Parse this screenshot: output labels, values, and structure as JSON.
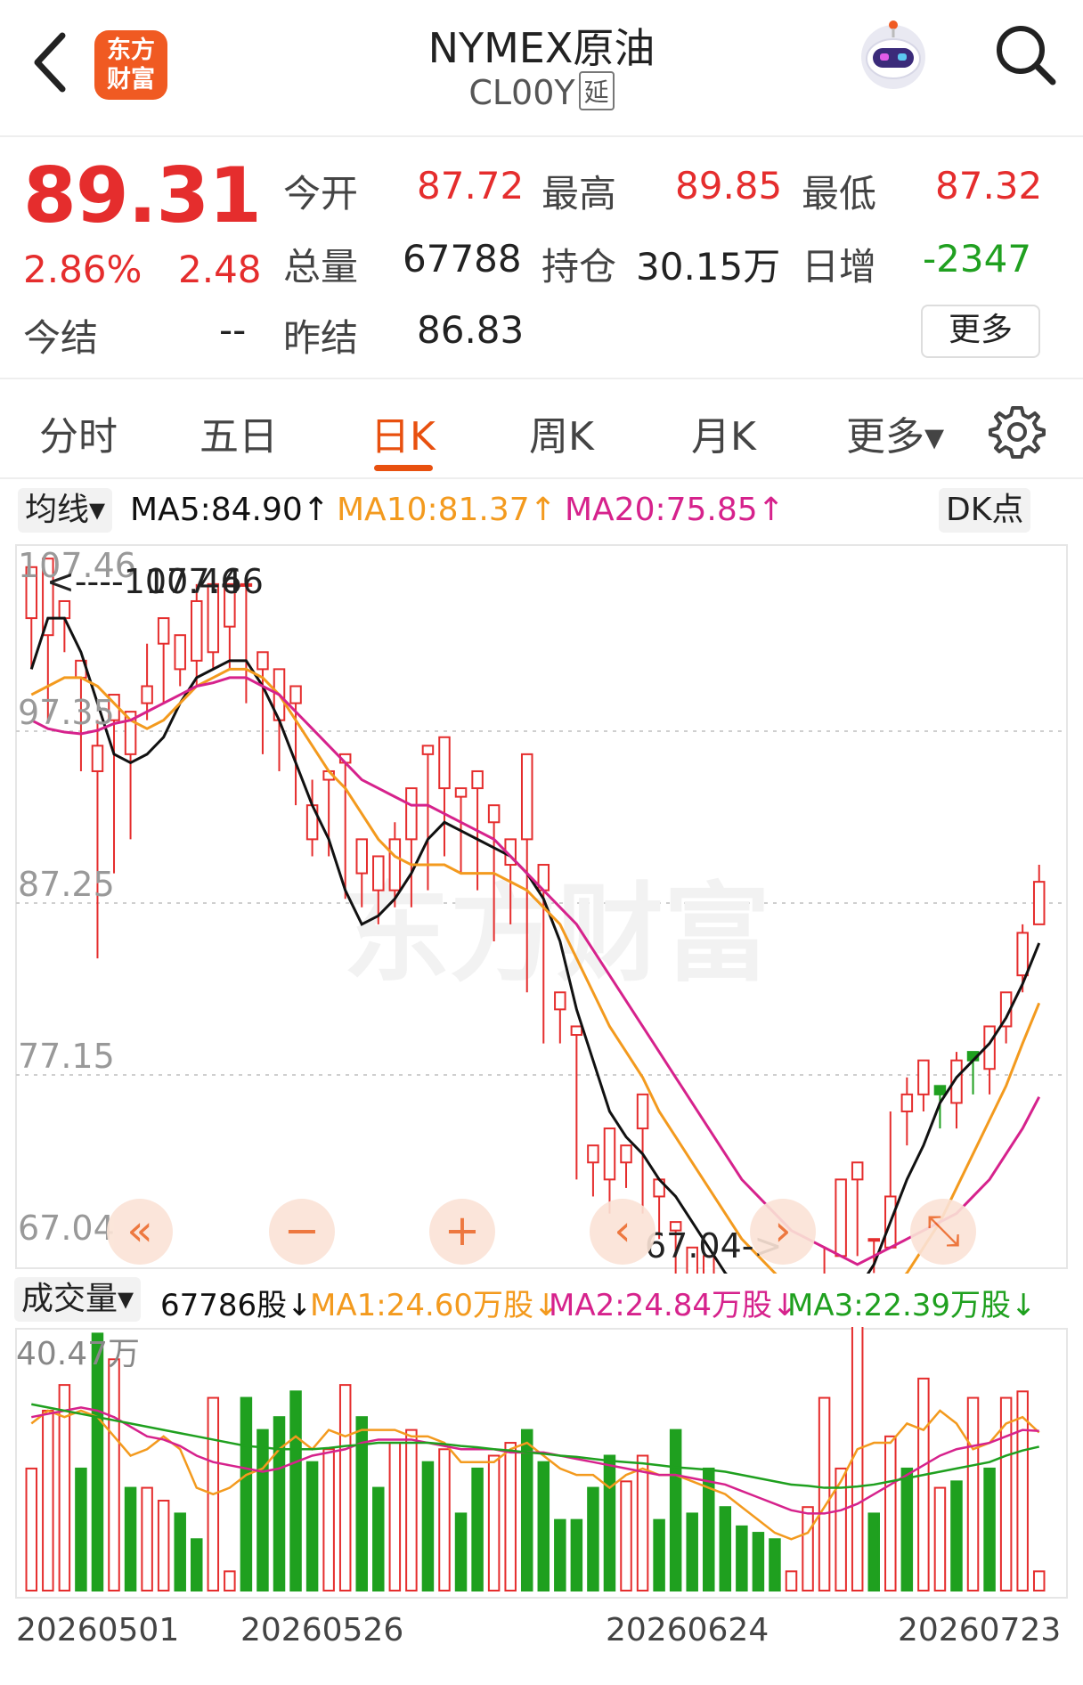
{
  "header": {
    "title": "NYMEX原油",
    "code": "CL00Y",
    "delay_tag": "延",
    "logo_line1": "东方",
    "logo_line2": "财富"
  },
  "quote": {
    "price": "89.31",
    "change_pct": "2.86%",
    "change": "2.48",
    "open_label": "今开",
    "open": "87.72",
    "high_label": "最高",
    "high": "89.85",
    "low_label": "最低",
    "low": "87.32",
    "volume_label": "总量",
    "volume": "67788",
    "oi_label": "持仓",
    "oi": "30.15万",
    "daily_inc_label": "日增",
    "daily_inc": "-2347",
    "settle_label": "今结",
    "settle": "--",
    "prev_settle_label": "昨结",
    "prev_settle": "86.83",
    "more_label": "更多"
  },
  "tabs": [
    {
      "label": "分时"
    },
    {
      "label": "五日"
    },
    {
      "label": "日K",
      "active": true
    },
    {
      "label": "周K"
    },
    {
      "label": "月K"
    },
    {
      "label": "更多▾"
    }
  ],
  "indicators": {
    "selector": "均线▾",
    "ma5": "MA5:84.90↑",
    "ma10": "MA10:81.37↑",
    "ma20": "MA20:75.85↑",
    "dk_label": "DK点",
    "ma5_color": "#111111",
    "ma10_color": "#f39a1e",
    "ma20_color": "#d6228c"
  },
  "volume_bar": {
    "selector": "成交量▾",
    "vol": "67786股↓",
    "ma1": "MA1:24.60万股↓",
    "ma2": "MA2:24.84万股↓",
    "ma3": "MA3:22.39万股↓",
    "max_label": "40.47万"
  },
  "colors": {
    "up": "#e52d2d",
    "down": "#1fa01f",
    "accent": "#e8500f"
  },
  "chart_data": {
    "type": "candlestick",
    "y_ticks": [
      "107.46",
      "97.35",
      "87.25",
      "77.15",
      "67.04"
    ],
    "ylim": [
      67.04,
      107.46
    ],
    "x_ticks": [
      "20260501",
      "20260526",
      "20260624",
      "20260723"
    ],
    "annotations": {
      "max": "<----107.46",
      "min": "67.04->"
    },
    "watermark": "东方财富",
    "candles": [
      [
        104,
        107,
        106,
        101
      ],
      [
        103,
        107.5,
        103.5,
        98
      ],
      [
        104,
        105,
        100.5,
        102
      ],
      [
        100.5,
        101.5,
        97,
        95
      ],
      [
        95,
        96.5,
        98,
        84
      ],
      [
        98,
        99.5,
        96.5,
        89
      ],
      [
        96,
        98.5,
        95,
        91
      ],
      [
        99,
        100,
        102.5,
        98
      ],
      [
        102.5,
        104,
        101.5,
        99
      ],
      [
        101,
        103,
        102,
        100
      ],
      [
        101.5,
        105,
        106,
        100
      ],
      [
        102,
        106,
        103,
        101
      ],
      [
        103.5,
        106,
        106,
        101
      ],
      [
        106,
        106,
        101,
        99
      ],
      [
        101,
        102,
        99,
        96
      ],
      [
        98,
        101,
        97,
        95
      ],
      [
        99,
        100,
        98,
        93
      ],
      [
        91,
        93,
        94.5,
        90
      ],
      [
        94.5,
        95,
        92,
        90
      ],
      [
        95.5,
        96,
        89,
        87.5
      ],
      [
        89,
        91,
        88.5,
        87
      ],
      [
        88,
        90,
        87.5,
        86
      ],
      [
        88,
        91,
        92,
        87
      ],
      [
        91,
        94,
        93,
        87
      ],
      [
        96,
        96.5,
        91.5,
        88
      ],
      [
        94,
        97,
        95,
        90
      ],
      [
        93.5,
        94,
        90,
        89
      ],
      [
        94,
        95,
        91.5,
        88
      ],
      [
        92,
        93,
        88,
        85
      ],
      [
        89.5,
        91,
        91,
        86
      ],
      [
        91,
        96,
        87,
        82
      ],
      [
        88,
        89.5,
        84,
        79
      ],
      [
        81,
        82,
        80,
        79
      ],
      [
        79.5,
        80,
        72,
        71
      ],
      [
        72,
        73,
        70.5,
        70
      ],
      [
        71,
        74,
        71.5,
        69
      ],
      [
        72,
        73,
        73,
        70.5
      ],
      [
        74,
        76,
        70,
        69
      ],
      [
        70,
        71,
        68,
        67.5
      ],
      [
        68,
        68.5,
        65,
        64.5
      ],
      [
        64,
        67,
        65.5,
        63
      ],
      [
        65,
        66.5,
        63.5,
        63
      ],
      [
        64,
        64.5,
        63,
        62.5
      ],
      [
        63,
        64.5,
        63.5,
        63
      ],
      [
        64,
        64.5,
        62,
        61.5
      ],
      [
        62,
        63,
        62.5,
        61
      ],
      [
        62.5,
        63.5,
        63,
        62
      ],
      [
        63,
        64,
        63.5,
        62
      ],
      [
        63.5,
        65,
        67,
        63
      ],
      [
        66.5,
        71,
        69,
        67
      ],
      [
        71,
        72,
        67.5,
        66.5
      ],
      [
        67.5,
        67.5,
        66,
        65.5
      ],
      [
        67,
        70,
        75,
        67
      ],
      [
        75,
        76,
        77,
        73
      ],
      [
        76,
        78,
        77,
        75
      ],
      [
        76.5,
        76,
        76,
        74
      ],
      [
        75.5,
        78,
        78.5,
        74
      ],
      [
        78.5,
        78,
        77.5,
        76
      ],
      [
        77.5,
        80,
        80,
        76
      ],
      [
        80,
        82,
        82,
        79
      ],
      [
        83,
        85.5,
        86,
        82
      ],
      [
        86,
        88.5,
        89.5,
        86
      ]
    ],
    "ma5": [
      101,
      104,
      104,
      102,
      99,
      96,
      95.5,
      96,
      97,
      99,
      100.5,
      101,
      101.5,
      101.5,
      100,
      98,
      95.5,
      93,
      91,
      88,
      86,
      86.5,
      87.5,
      89,
      91,
      92,
      91.5,
      91,
      90.5,
      90,
      89,
      87.5,
      85,
      81,
      78,
      75,
      73.5,
      72.5,
      71,
      70,
      68.5,
      67,
      65.5,
      64.5,
      64,
      63.5,
      63,
      62.5,
      62.5,
      63,
      64.5,
      66,
      68.5,
      71,
      73,
      75.5,
      77,
      78,
      79,
      80.5,
      82.5,
      84.9
    ],
    "ma10": [
      99.5,
      100,
      100.5,
      100.5,
      100,
      99,
      98,
      97.5,
      98,
      99,
      100,
      100.5,
      101,
      101,
      100.5,
      99.5,
      98,
      96.5,
      95,
      94,
      92.5,
      91,
      90,
      89.5,
      89.5,
      89.5,
      89,
      89,
      89,
      88.5,
      88,
      87,
      86,
      84,
      82,
      80,
      78.5,
      77,
      75,
      73.5,
      72,
      70.5,
      69,
      67.5,
      66.5,
      65.5,
      64.5,
      64,
      63.5,
      63.5,
      63.5,
      64,
      64.5,
      65.5,
      67,
      68.5,
      70.5,
      72.5,
      74.5,
      76.5,
      79,
      81.37
    ],
    "ma20": [
      98,
      97.5,
      97.3,
      97.2,
      97.4,
      97.8,
      98,
      98.5,
      99,
      99.5,
      100,
      100.2,
      100.5,
      100.5,
      100,
      99.5,
      98.5,
      97.5,
      96.5,
      95.5,
      94.5,
      94,
      93.5,
      93,
      93,
      92.5,
      92,
      91.5,
      91,
      90,
      89,
      88,
      87,
      86,
      84.5,
      83,
      81.5,
      80,
      78.5,
      77,
      75.5,
      74,
      72.5,
      71,
      70,
      69,
      68,
      67.5,
      67,
      66.5,
      66,
      66.5,
      67,
      67.5,
      68,
      68.5,
      69,
      70,
      71,
      72.5,
      74,
      75.85
    ],
    "volume_max": 40.47,
    "volumes": [
      [
        19,
        1
      ],
      [
        28,
        1
      ],
      [
        32,
        1
      ],
      [
        19,
        0
      ],
      [
        40,
        0
      ],
      [
        36,
        1
      ],
      [
        16,
        0
      ],
      [
        16,
        1
      ],
      [
        14,
        1
      ],
      [
        12,
        0
      ],
      [
        8,
        0
      ],
      [
        30,
        1
      ],
      [
        3,
        1
      ],
      [
        30,
        0
      ],
      [
        25,
        0
      ],
      [
        27,
        0
      ],
      [
        31,
        0
      ],
      [
        20,
        0
      ],
      [
        22,
        1
      ],
      [
        32,
        1
      ],
      [
        27,
        0
      ],
      [
        16,
        0
      ],
      [
        23,
        1
      ],
      [
        25,
        1
      ],
      [
        20,
        0
      ],
      [
        22,
        1
      ],
      [
        12,
        0
      ],
      [
        19,
        0
      ],
      [
        21,
        1
      ],
      [
        23,
        1
      ],
      [
        25,
        0
      ],
      [
        20,
        0
      ],
      [
        11,
        0
      ],
      [
        11,
        0
      ],
      [
        16,
        0
      ],
      [
        21,
        0
      ],
      [
        17,
        1
      ],
      [
        21,
        1
      ],
      [
        11,
        0
      ],
      [
        25,
        0
      ],
      [
        12,
        0
      ],
      [
        19,
        0
      ],
      [
        13,
        0
      ],
      [
        10,
        0
      ],
      [
        9,
        0
      ],
      [
        8,
        0
      ],
      [
        3,
        1
      ],
      [
        13,
        1
      ],
      [
        30,
        1
      ],
      [
        19,
        1
      ],
      [
        42,
        1
      ],
      [
        12,
        0
      ],
      [
        24,
        1
      ],
      [
        19,
        0
      ],
      [
        33,
        1
      ],
      [
        16,
        1
      ],
      [
        17,
        0
      ],
      [
        30,
        1
      ],
      [
        19,
        0
      ],
      [
        30,
        1
      ],
      [
        31,
        1
      ],
      [
        3,
        1
      ]
    ],
    "vol_ma1": [
      26,
      28,
      27,
      28,
      27,
      24,
      21,
      22,
      24,
      22,
      16,
      15,
      16,
      18,
      19,
      22,
      24,
      22,
      25,
      24,
      25,
      25,
      25,
      24,
      24,
      23,
      20,
      20,
      20,
      22,
      23,
      21,
      19,
      18,
      18,
      16,
      18,
      19,
      18,
      18,
      17,
      16,
      15,
      13,
      11,
      9,
      8,
      9,
      13,
      17,
      22,
      23,
      23,
      26,
      25,
      28,
      26,
      22,
      23,
      26,
      27,
      24.6
    ],
    "vol_ma2": [
      27,
      27.5,
      28,
      28.5,
      28,
      27,
      25.5,
      24,
      23.5,
      22.5,
      21,
      20,
      19.5,
      19,
      18.5,
      19,
      20,
      21,
      21.5,
      22,
      23,
      23.5,
      23.5,
      23.5,
      23,
      22.5,
      22,
      22,
      22,
      21.5,
      21.5,
      21.5,
      21,
      20.5,
      20,
      19.5,
      19,
      18.5,
      18,
      18,
      17.5,
      17,
      16.5,
      15.5,
      14.5,
      13.5,
      12.5,
      12,
      12,
      12.5,
      13.5,
      15,
      16.5,
      18,
      19.5,
      21,
      22,
      22.5,
      23,
      24,
      25,
      24.84
    ],
    "vol_ma3": [
      29,
      28.5,
      28,
      27.5,
      27,
      26.5,
      26,
      25.5,
      25,
      24.5,
      24,
      23.5,
      23,
      22.5,
      22.3,
      22,
      22,
      22,
      22.2,
      22.5,
      22.7,
      23,
      23,
      23,
      23,
      22.8,
      22.5,
      22.3,
      22,
      21.8,
      21.5,
      21.3,
      21,
      20.8,
      20.5,
      20.2,
      20,
      19.8,
      19.5,
      19.2,
      19,
      18.8,
      18.5,
      18,
      17.5,
      17,
      16.5,
      16.3,
      16,
      16,
      16.2,
      16.5,
      17,
      17.5,
      18,
      18.5,
      19,
      19.5,
      20,
      21,
      21.8,
      22.39
    ]
  }
}
